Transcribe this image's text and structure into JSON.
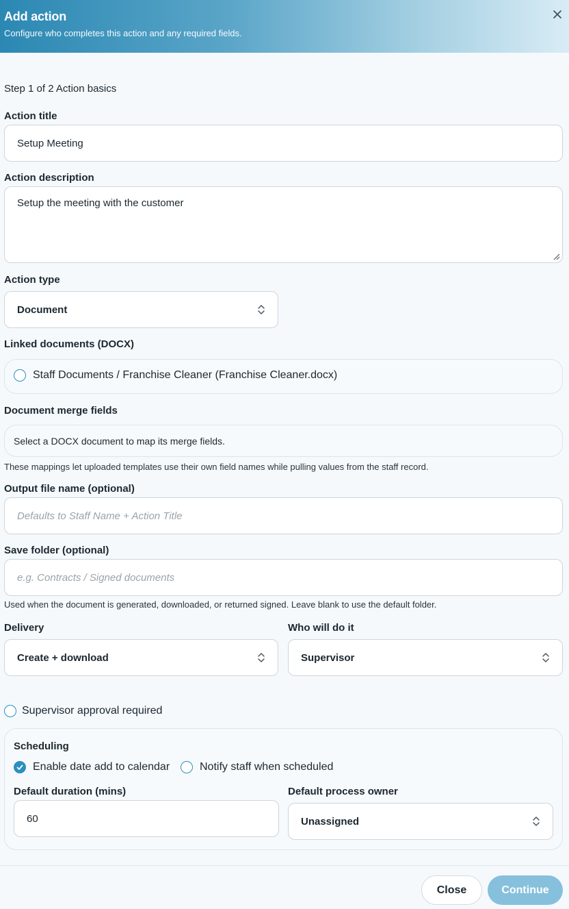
{
  "header": {
    "title": "Add action",
    "subtitle": "Configure who completes this action and any required fields."
  },
  "step": {
    "text": "Step 1 of 2  Action basics"
  },
  "action_title": {
    "label": "Action title",
    "value": "Setup Meeting"
  },
  "action_description": {
    "label": "Action description",
    "value": "Setup the meeting with the customer"
  },
  "action_type": {
    "label": "Action type",
    "value": "Document"
  },
  "linked_documents": {
    "label": "Linked documents (DOCX)",
    "items": [
      {
        "label": "Staff Documents / Franchise Cleaner (Franchise Cleaner.docx)",
        "checked": false
      }
    ]
  },
  "merge_fields": {
    "label": "Document merge fields",
    "box_text": "Select a DOCX document to map its merge fields.",
    "note": "These mappings let uploaded templates use their own field names while pulling values from the staff record."
  },
  "output_file": {
    "label": "Output file name (optional)",
    "placeholder": "Defaults to Staff Name + Action Title"
  },
  "save_folder": {
    "label": "Save folder (optional)",
    "placeholder": "e.g. Contracts / Signed documents",
    "note": "Used when the document is generated, downloaded, or returned signed. Leave blank to use the default folder."
  },
  "delivery": {
    "label": "Delivery",
    "value": "Create + download"
  },
  "who": {
    "label": "Who will do it",
    "value": "Supervisor"
  },
  "approval": {
    "label": "Supervisor approval required",
    "checked": false
  },
  "scheduling": {
    "title": "Scheduling",
    "enable_calendar": {
      "label": "Enable date add to calendar",
      "checked": true
    },
    "notify_staff": {
      "label": "Notify staff when scheduled",
      "checked": false
    },
    "duration": {
      "label": "Default duration (mins)",
      "value": "60"
    },
    "owner": {
      "label": "Default process owner",
      "value": "Unassigned"
    }
  },
  "footer": {
    "close_label": "Close",
    "continue_label": "Continue"
  },
  "colors": {
    "accent": "#2b8fbf",
    "continue_bg": "#86c0dc"
  }
}
